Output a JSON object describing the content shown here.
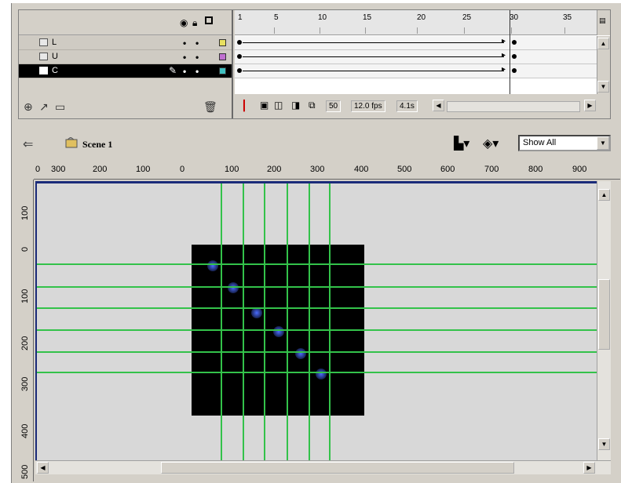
{
  "timeline": {
    "header_icons": [
      "eye-icon",
      "lock-icon",
      "outline-icon"
    ],
    "frame_numbers": [
      "1",
      "5",
      "10",
      "15",
      "20",
      "25",
      "30",
      "35"
    ],
    "layers": [
      {
        "name": "L",
        "color": "#e8e060",
        "selected": false
      },
      {
        "name": "U",
        "color": "#c070d0",
        "selected": false
      },
      {
        "name": "C",
        "color": "#40c0c0",
        "selected": true
      }
    ],
    "status": {
      "current_frame": "50",
      "frame_rate": "12.0 fps",
      "elapsed": "4.1s"
    }
  },
  "scene": {
    "label": "Scene 1",
    "zoom": "Show All"
  },
  "rulers": {
    "horizontal": [
      "0",
      "300",
      "200",
      "100",
      "0",
      "100",
      "200",
      "300",
      "400",
      "500",
      "600",
      "700",
      "800",
      "900"
    ],
    "vertical": [
      "100",
      "0",
      "100",
      "200",
      "300",
      "400",
      "500"
    ]
  },
  "colors": {
    "guide": "#33c24a",
    "stage_border": "#1a2b7a",
    "canvas": "#000000"
  }
}
